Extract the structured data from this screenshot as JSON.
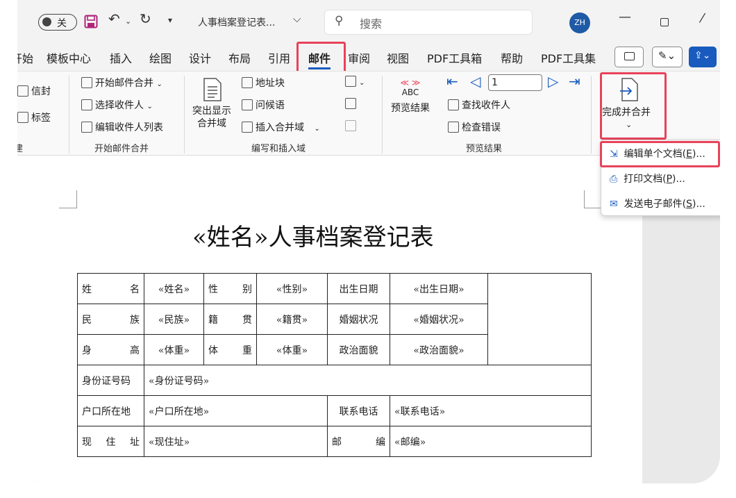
{
  "titlebar": {
    "autosave_label": "关",
    "doc_title": "人事档案登记表...",
    "search_placeholder": "搜索",
    "avatar_initials": "ZH"
  },
  "tabs": [
    {
      "label": "开始"
    },
    {
      "label": "模板中心"
    },
    {
      "label": "插入"
    },
    {
      "label": "绘图"
    },
    {
      "label": "设计"
    },
    {
      "label": "布局"
    },
    {
      "label": "引用"
    },
    {
      "label": "邮件"
    },
    {
      "label": "审阅"
    },
    {
      "label": "视图"
    },
    {
      "label": "PDF工具箱"
    },
    {
      "label": "帮助"
    },
    {
      "label": "PDF工具集"
    }
  ],
  "ribbon": {
    "create": {
      "envelope": "信封",
      "label": "标签",
      "group": "建"
    },
    "start_merge": {
      "start": "开始邮件合并",
      "select": "选择收件人",
      "edit_list": "编辑收件人列表",
      "group": "开始邮件合并"
    },
    "write_insert": {
      "highlight_line1": "突出显示",
      "highlight_line2": "合并域",
      "address_block": "地址块",
      "greeting": "问候语",
      "insert_field": "插入合并域",
      "group": "编写和插入域"
    },
    "preview": {
      "abc": "ABC",
      "preview_results": "预览结果",
      "record_number": "1",
      "find_recipient": "查找收件人",
      "check_errors": "检查错误",
      "group": "预览结果"
    },
    "finish": {
      "label": "完成并合并"
    }
  },
  "dropdown": {
    "items": [
      {
        "label": "编辑单个文档(",
        "key": "E",
        "tail": ")..."
      },
      {
        "label": "打印文档(",
        "key": "P",
        "tail": ")..."
      },
      {
        "label": "发送电子邮件(",
        "key": "S",
        "tail": ")..."
      }
    ]
  },
  "document": {
    "title": "«姓名»人事档案登记表",
    "rows": [
      [
        "姓名",
        "«姓名»",
        "性别",
        "«性别»",
        "出生日期",
        "«出生日期»"
      ],
      [
        "民族",
        "«民族»",
        "籍贯",
        "«籍贯»",
        "婚姻状况",
        "«婚姻状况»"
      ],
      [
        "身高",
        "«体重»",
        "体重",
        "«体重»",
        "政治面貌",
        "«政治面貌»"
      ],
      [
        "身份证号码",
        "«身份证号码»"
      ],
      [
        "户口所在地",
        "«户口所在地»",
        "联系电话",
        "«联系电话»"
      ],
      [
        "现住址",
        "«现住址»",
        "邮编",
        "«邮编»"
      ]
    ]
  },
  "colors": {
    "accent": "#185abd",
    "highlight": "#e8425a",
    "save_icon": "#b0247a"
  }
}
